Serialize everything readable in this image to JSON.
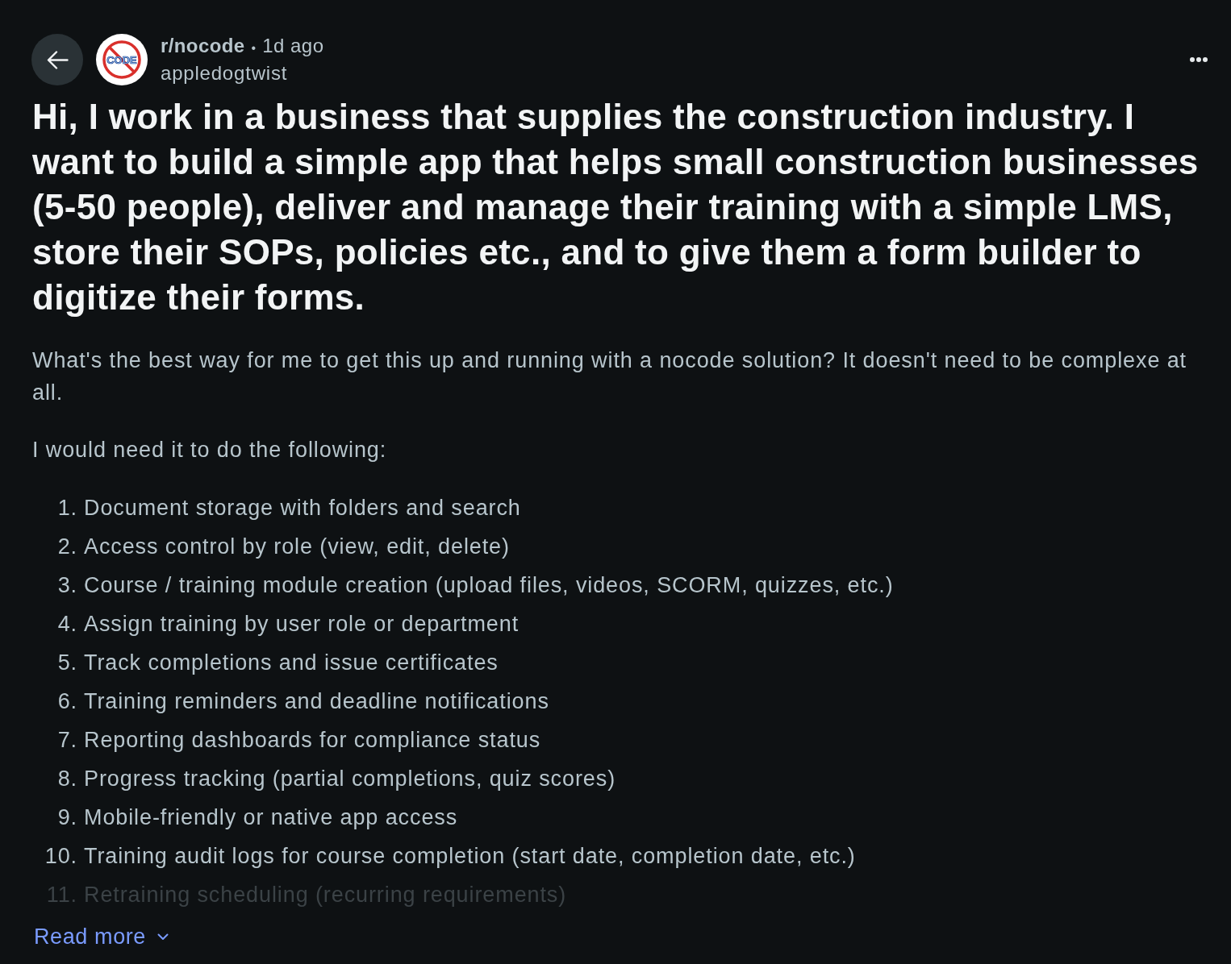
{
  "header": {
    "avatar_text": "CODE",
    "subreddit": "r/nocode",
    "separator": "•",
    "time": "1d ago",
    "author": "appledogtwist"
  },
  "post": {
    "title": "Hi, I work in a business that supplies the construction industry. I want to build a simple app that helps small construction businesses (5-50 people), deliver and manage their training with a simple LMS, store their SOPs, policies etc., and to give them a form builder to digitize their forms.",
    "paragraphs": [
      "What's the best way for me to get this up and running with a nocode solution? It doesn't need to be complexe at all.",
      "I would need it to do the following:"
    ],
    "list": [
      {
        "number": "1.",
        "text": "Document storage with folders and search",
        "faded": false
      },
      {
        "number": "2.",
        "text": "Access control by role (view, edit, delete)",
        "faded": false
      },
      {
        "number": "3.",
        "text": "Course / training module creation (upload files, videos, SCORM, quizzes, etc.)",
        "faded": false
      },
      {
        "number": "4.",
        "text": "Assign training by user role or department",
        "faded": false
      },
      {
        "number": "5.",
        "text": "Track completions and issue certificates",
        "faded": false
      },
      {
        "number": "6.",
        "text": "Training reminders and deadline notifications",
        "faded": false
      },
      {
        "number": "7.",
        "text": "Reporting dashboards for compliance status",
        "faded": false
      },
      {
        "number": "8.",
        "text": "Progress tracking (partial completions, quiz scores)",
        "faded": false
      },
      {
        "number": "9.",
        "text": "Mobile-friendly or native app access",
        "faded": false
      },
      {
        "number": "10.",
        "text": "Training audit logs for course completion (start date, completion date, etc.)",
        "faded": false
      },
      {
        "number": "11.",
        "text": "Retraining scheduling (recurring requirements)",
        "faded": true
      }
    ],
    "read_more": "Read more"
  }
}
